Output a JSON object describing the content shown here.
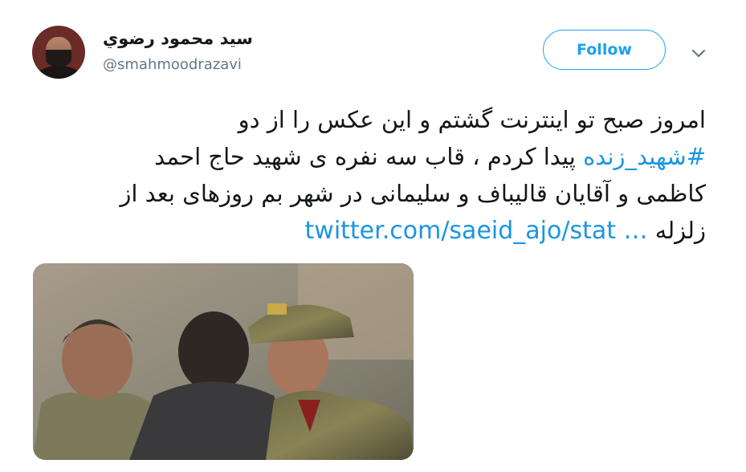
{
  "author": {
    "display_name": "سید محمود رضوي",
    "handle": "@smahmoodrazavi"
  },
  "actions": {
    "follow_label": "Follow"
  },
  "tweet": {
    "line1": "امروز صبح تو اینترنت گشتم و این عکس را از دو",
    "hashtag": "#شهید_زنده",
    "line2_rest": " پیدا کردم ، قاب سه نفره ی شهید حاج احمد",
    "line3": "کاظمی و آقایان قالیباف و سلیمانی در شهر بم روزهای بعد از",
    "line4_text": "زلزله ",
    "link": "twitter.com/saeid_ajo/stat …"
  },
  "icons": {
    "more": "chevron-down-icon"
  },
  "colors": {
    "accent": "#1da1f2",
    "link": "#1b95e0",
    "secondary_text": "#657786"
  }
}
